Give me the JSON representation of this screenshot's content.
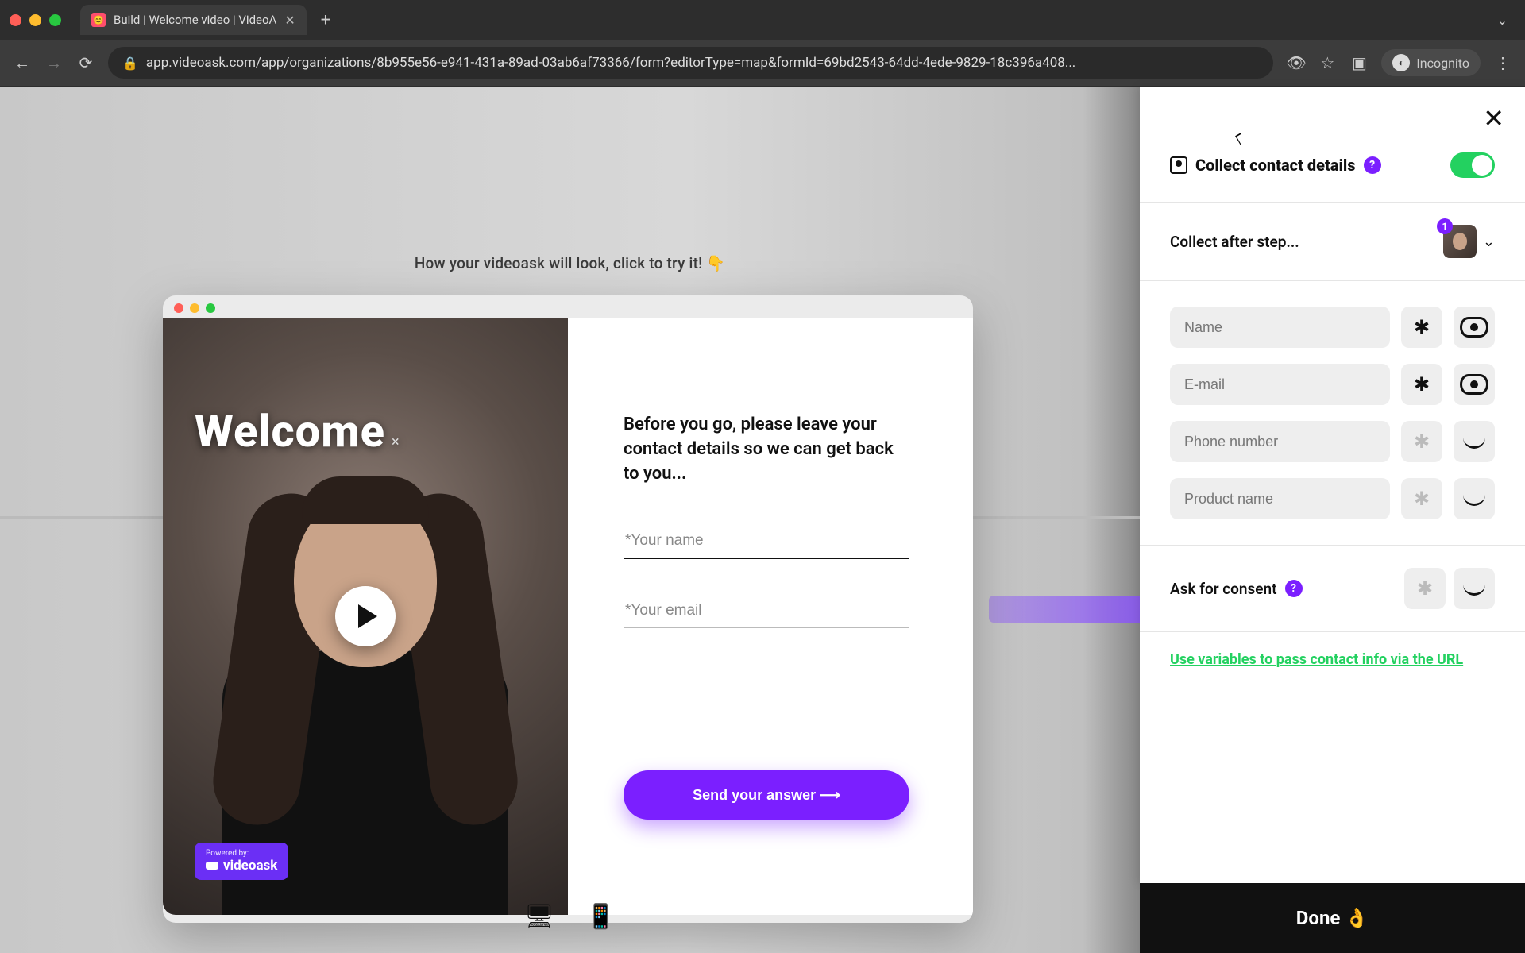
{
  "browser": {
    "tab_title": "Build | Welcome video | VideoA",
    "url": "app.videoask.com/app/organizations/8b955e56-e941-431a-89ad-03ab6af73366/form?editorType=map&formId=69bd2543-64dd-4ede-9829-18c396a408...",
    "profile_label": "Incognito"
  },
  "canvas": {
    "hint": "How your videoask will look, click to try it! 👇"
  },
  "preview": {
    "overlay_title": "Welcome",
    "powered_small": "Powered by:",
    "powered_brand": "videoask",
    "form_prompt": "Before you go, please leave your contact details so we can get back to you...",
    "name_placeholder": "*Your name",
    "email_placeholder": "*Your email",
    "send_label": "Send your answer ⟶"
  },
  "sidebar": {
    "title": "Collect contact details",
    "collect_after": "Collect after step...",
    "step_number": "1",
    "fields": [
      {
        "placeholder": "Name",
        "required": true,
        "visible": true
      },
      {
        "placeholder": "E-mail",
        "required": true,
        "visible": true
      },
      {
        "placeholder": "Phone number",
        "required": false,
        "visible": false
      },
      {
        "placeholder": "Product name",
        "required": false,
        "visible": false
      }
    ],
    "consent_label": "Ask for consent",
    "vars_link": "Use variables to pass contact info via the URL",
    "done_label": "Done 👌"
  }
}
